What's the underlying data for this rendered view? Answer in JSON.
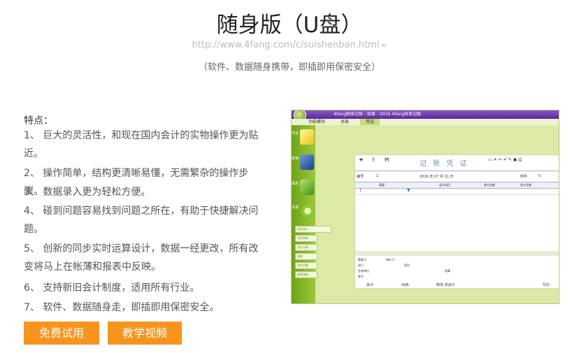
{
  "header": {
    "title": "随身版（U盘）",
    "url": "http://www.4fang.com/c/suishenban.html",
    "subtitle": "（软件、数据随身携带，即插即用保密安全）"
  },
  "features": {
    "heading": "特点：",
    "items": [
      "1、 巨大的灵活性，和现在国内会计的实物操作更为贴近。",
      "2、 操作简单，结构更清晰易懂，无需繁杂的操作步骤。",
      "3、 数据录入更为轻松方便。",
      "4、 碰到问题容易找到问题之所在，有助于快捷解决问题。",
      "5、 创新的同步实时运算设计，数据一经更改，所有改变将马上在帐薄和报表中反映。",
      "6、 支持新旧会计制度，适用所有行业。",
      "7、 软件、数据随身走，即插即用保密安全。"
    ]
  },
  "buttons": {
    "free_trial": "免费试用",
    "tutorial_video": "教学视频"
  },
  "screenshot": {
    "window_title": "4Fang随身记账 - 账套 - 2016 4Fang财务记账",
    "menu": [
      "功能模块",
      "总账",
      "凭证"
    ],
    "sidebar": [
      "凭证",
      "账簿",
      "报表",
      "设置"
    ],
    "sub_links": [
      "凭证录入",
      "凭证审核",
      "凭证记账",
      "结账",
      "科目设置",
      "账套管理"
    ],
    "voucher_title": "记 账 凭 证",
    "voucher_no_label": "编号",
    "voucher_no": "1",
    "voucher_date": "2016 年 07 月 21 日",
    "attach_label": "附件",
    "attach_count": "0",
    "col_summary": "摘要",
    "col_account": "会计科目",
    "col_debit": "借方金额",
    "col_credit": "贷方金额",
    "row_no": "1",
    "footer_fields": [
      "数量 0",
      "单价 0",
      "部门",
      "项目",
      "往来单位",
      "结算",
      "票号"
    ],
    "footer_bottom": [
      "会计:",
      "出纳:",
      "制单:张会计"
    ],
    "help": "帮助",
    "colors": {
      "accent": "#f7941d",
      "sidebar": "#7fb22a",
      "panel": "#dde9a7"
    }
  }
}
